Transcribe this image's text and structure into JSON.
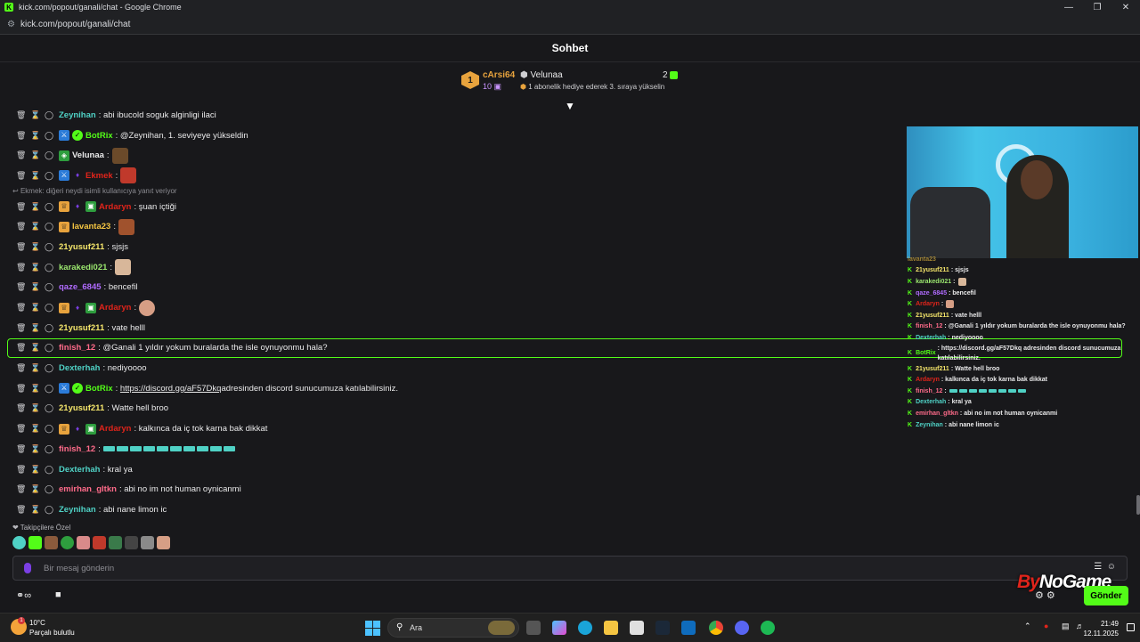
{
  "browser": {
    "title": "kick.com/popout/ganali/chat - Google Chrome",
    "url": "kick.com/popout/ganali/chat"
  },
  "header": {
    "title": "Sohbet"
  },
  "pinned": {
    "rank": "1",
    "top_user": "cArsi64",
    "top_count": "10",
    "user2": "Velunaa",
    "user2_count": "2",
    "note": "1 abonelik hediye ederek 3. sıraya yükselin"
  },
  "messages": [
    {
      "user": "Zeynihan",
      "color": "#4fd1c5",
      "text": ": abi ibucold soguk alginligi ilaci"
    },
    {
      "user": "BotRix",
      "color": "#53fc18",
      "text": ": @Zeynihan, 1. seviyeye yükseldin"
    },
    {
      "user": "Velunaa",
      "color": "#e9e9ea",
      "text": ":"
    },
    {
      "user": "Ekmek",
      "color": "#e0241b",
      "text": ":"
    },
    {
      "reply": "Ekmek: diğeri neydi isimli kullanıcıya yanıt veriyor"
    },
    {
      "user": "Ardaryn",
      "color": "#e0241b",
      "text": ": şuan içtiği"
    },
    {
      "user": "lavanta23",
      "color": "#f5c542",
      "text": ":"
    },
    {
      "user": "21yusuf211",
      "color": "#f5e66b",
      "text": ": sjsjs"
    },
    {
      "user": "karakedi021",
      "color": "#9ae66e",
      "text": ":"
    },
    {
      "user": "qaze_6845",
      "color": "#b06bff",
      "text": ": bencefil"
    },
    {
      "user": "Ardaryn",
      "color": "#e0241b",
      "text": ":"
    },
    {
      "user": "21yusuf211",
      "color": "#f5e66b",
      "text": ": vate helll"
    },
    {
      "user": "finish_12",
      "color": "#ff6b8a",
      "text": ": @Ganali 1 yıldır yokum buralarda the isle oynuyonmu hala?"
    },
    {
      "user": "Dexterhah",
      "color": "#4fd1c5",
      "text": ": nediyoooo"
    },
    {
      "user": "BotRix",
      "color": "#53fc18",
      "link": "https://discord.gg/aF57Dkq",
      "text": " adresinden discord sunucumuza katılabilirsiniz."
    },
    {
      "user": "21yusuf211",
      "color": "#f5e66b",
      "text": ": Watte hell broo"
    },
    {
      "user": "Ardaryn",
      "color": "#e0241b",
      "text": ": kalkınca da iç tok karna bak dikkat"
    },
    {
      "user": "finish_12",
      "color": "#ff6b8a",
      "text": ":"
    },
    {
      "user": "Dexterhah",
      "color": "#4fd1c5",
      "text": ": kral ya"
    },
    {
      "user": "emirhan_gltkn",
      "color": "#ff6b8a",
      "text": ": abi no im not human oynicanmi"
    },
    {
      "user": "Zeynihan",
      "color": "#4fd1c5",
      "text": ": abi nane limon ic"
    }
  ],
  "followers_only": "Takipçilere Özel",
  "input": {
    "placeholder": "Bir mesaj gönderin"
  },
  "send_label": "Gönder",
  "watermark": {
    "a": "By",
    "b": "NoGame"
  },
  "overlay": [
    {
      "user": "lavanta23",
      "color": "#f5c542",
      "text": ""
    },
    {
      "user": "21yusuf211",
      "color": "#f5e66b",
      "text": ": sjsjs"
    },
    {
      "user": "karakedi021",
      "color": "#9ae66e",
      "text": ":"
    },
    {
      "user": "qaze_6845",
      "color": "#b06bff",
      "text": ": bencefil"
    },
    {
      "user": "Ardaryn",
      "color": "#e0241b",
      "text": ":"
    },
    {
      "user": "21yusuf211",
      "color": "#f5e66b",
      "text": ": vate helll"
    },
    {
      "user": "finish_12",
      "color": "#ff6b8a",
      "text": ": @Ganali 1 yıldır yokum buralarda the isle oynuyonmu hala?"
    },
    {
      "user": "Dexterhah",
      "color": "#4fd1c5",
      "text": ": nediyoooo"
    },
    {
      "user": "BotRix",
      "color": "#53fc18",
      "text": ": https://discord.gg/aF57Dkq adresinden discord sunucumuza katılabilirsiniz.",
      "wrap": true
    },
    {
      "user": "21yusuf211",
      "color": "#f5e66b",
      "text": ": Watte hell broo"
    },
    {
      "user": "Ardaryn",
      "color": "#e0241b",
      "text": ": kalkınca da iç tok karna bak dikkat"
    },
    {
      "user": "finish_12",
      "color": "#ff6b8a",
      "text": ":"
    },
    {
      "user": "Dexterhah",
      "color": "#4fd1c5",
      "text": ": kral ya"
    },
    {
      "user": "emirhan_gltkn",
      "color": "#ff6b8a",
      "text": ": abi no im not human oynicanmi"
    },
    {
      "user": "Zeynihan",
      "color": "#4fd1c5",
      "text": ": abi nane limon ic"
    }
  ],
  "taskbar": {
    "weather_temp": "10°C",
    "weather_desc": "Parçalı bulutlu",
    "weather_badge": "1",
    "search": "Ara",
    "time": "21:49",
    "date": "12.11.2025"
  },
  "colors": {
    "accent": "#53fc18",
    "bg": "#18181b"
  }
}
